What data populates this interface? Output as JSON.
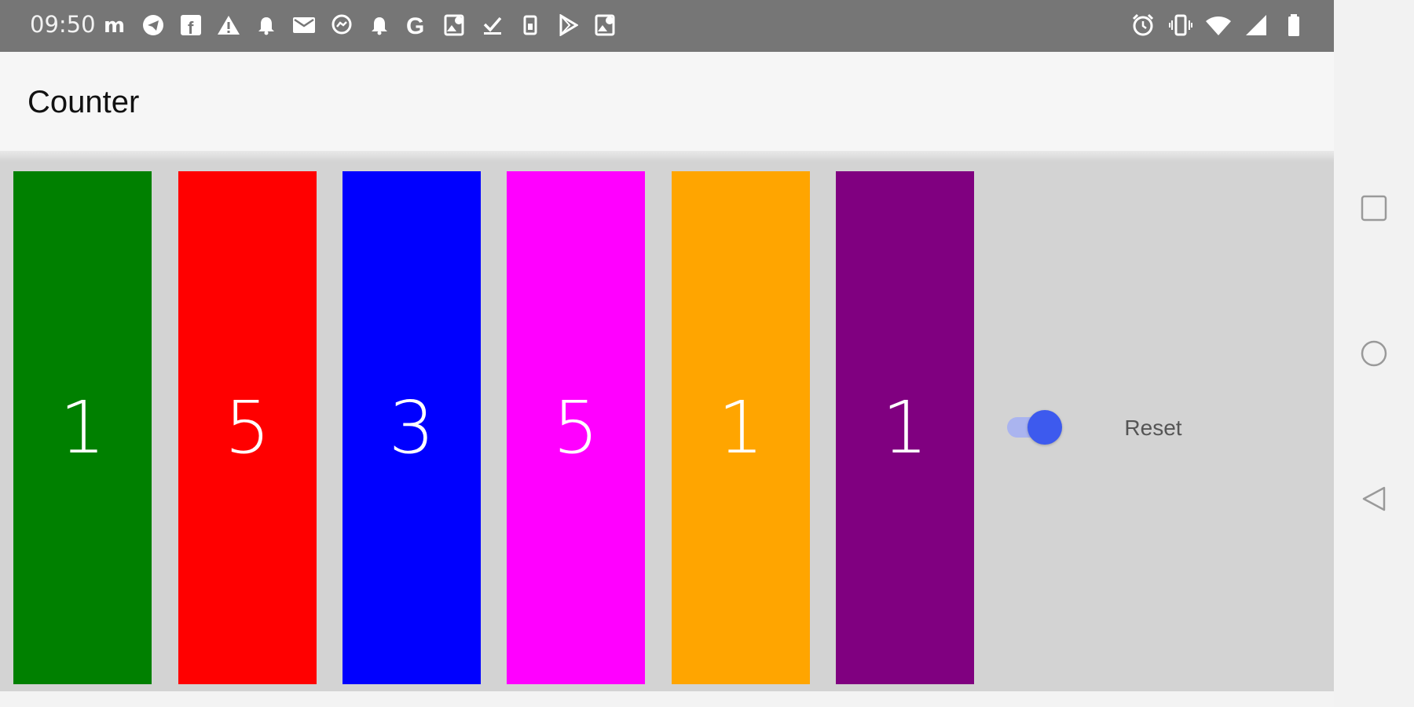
{
  "status_bar": {
    "time": "09:50",
    "notification_icons": [
      "m-icon",
      "telegram-icon",
      "facebook-icon",
      "warning-icon",
      "bell-icon",
      "mail-icon",
      "messenger-icon",
      "bell-icon",
      "google-icon",
      "image-icon",
      "check-icon",
      "sim-icon",
      "play-store-icon",
      "image-icon"
    ],
    "system_icons": [
      "alarm-icon",
      "vibrate-icon",
      "wifi-icon",
      "signal-icon",
      "battery-icon"
    ]
  },
  "app_bar": {
    "title": "Counter"
  },
  "counters": [
    {
      "value": "1",
      "color": "#008000"
    },
    {
      "value": "5",
      "color": "#ff0000"
    },
    {
      "value": "3",
      "color": "#0000ff"
    },
    {
      "value": "5",
      "color": "#ff00ff"
    },
    {
      "value": "1",
      "color": "#ffa500"
    },
    {
      "value": "1",
      "color": "#800080"
    }
  ],
  "toggle": {
    "checked": true,
    "accent": "#3d5aee"
  },
  "reset": {
    "label": "Reset"
  },
  "nav_bar": {
    "buttons": [
      "recents-square-icon",
      "home-circle-icon",
      "back-triangle-icon"
    ]
  }
}
